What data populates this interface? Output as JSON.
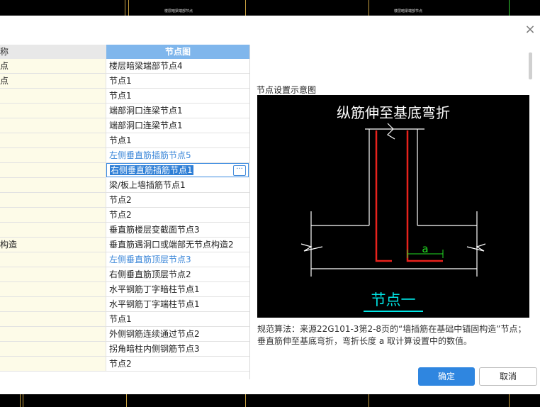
{
  "top_strip": {
    "left_text": "楼层暗梁端部节点",
    "right_text": "楼层暗梁端部节点"
  },
  "table": {
    "headers": {
      "name": "称",
      "node": "节点图"
    },
    "rows": [
      {
        "name": "点",
        "node": "楼层暗梁端部节点4",
        "style": ""
      },
      {
        "name": "点",
        "node": "节点1",
        "style": ""
      },
      {
        "name": "",
        "node": "节点1",
        "style": ""
      },
      {
        "name": "",
        "node": "端部洞口连梁节点1",
        "style": ""
      },
      {
        "name": "",
        "node": "端部洞口连梁节点1",
        "style": ""
      },
      {
        "name": "",
        "node": "节点1",
        "style": ""
      },
      {
        "name": "",
        "node": "左侧垂直筋插筋节点5",
        "style": "blue"
      },
      {
        "name": "",
        "node": "右侧垂直筋插筋节点1",
        "style": "sel"
      },
      {
        "name": "",
        "node": "梁/板上墙插筋节点1",
        "style": ""
      },
      {
        "name": "",
        "node": "节点2",
        "style": ""
      },
      {
        "name": "",
        "node": "节点2",
        "style": ""
      },
      {
        "name": "",
        "node": "垂直筋楼层变截面节点3",
        "style": ""
      },
      {
        "name": "构造",
        "node": "垂直筋遇洞口或端部无节点构造2",
        "style": ""
      },
      {
        "name": "",
        "node": "左侧垂直筋顶层节点3",
        "style": "blue"
      },
      {
        "name": "",
        "node": "右侧垂直筋顶层节点2",
        "style": ""
      },
      {
        "name": "",
        "node": "水平钢筋丁字暗柱节点1",
        "style": ""
      },
      {
        "name": "",
        "node": "水平钢筋丁字端柱节点1",
        "style": ""
      },
      {
        "name": "",
        "node": "节点1",
        "style": ""
      },
      {
        "name": "",
        "node": "外侧钢筋连续通过节点2",
        "style": ""
      },
      {
        "name": "",
        "node": "拐角暗柱内侧钢筋节点3",
        "style": ""
      },
      {
        "name": "",
        "node": "节点2",
        "style": ""
      }
    ],
    "more_button": "···"
  },
  "preview": {
    "label": "节点设置示意图",
    "diagram_title": "纵筋伸至基底弯折",
    "dimension_label": "a",
    "node_caption": "节点一",
    "description": "规范算法：来源22G101-3第2-8页的“墙插筋在基础中锚固构造”节点；垂直筋伸至基底弯折，弯折长度 a 取计算设置中的数值。",
    "colors": {
      "rebar": "#e8221c",
      "dimension": "#22dd22",
      "caption": "#00e6e6",
      "outline": "#ffffff"
    }
  },
  "buttons": {
    "ok": "确定",
    "cancel": "取消"
  },
  "close_glyph": "×"
}
